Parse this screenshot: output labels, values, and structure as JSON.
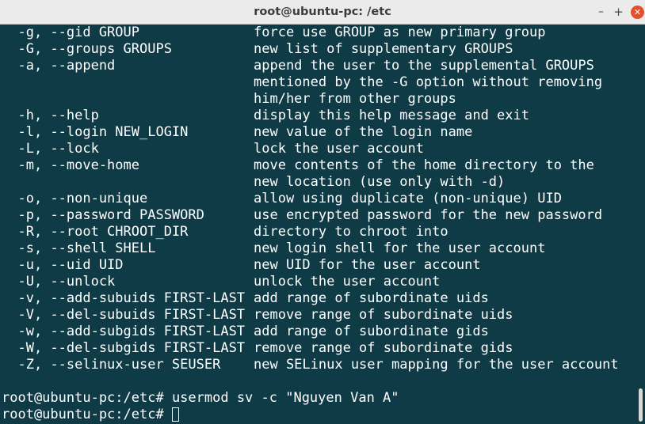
{
  "window": {
    "title": "root@ubuntu-pc: /etc",
    "minimize_symbol": "–",
    "maximize_symbol": "+",
    "close_symbol": "✕"
  },
  "terminal": {
    "help_lines": [
      {
        "option": "  -g, --gid GROUP",
        "description": "force use GROUP as new primary group"
      },
      {
        "option": "  -G, --groups GROUPS",
        "description": "new list of supplementary GROUPS"
      },
      {
        "option": "  -a, --append",
        "description": "append the user to the supplemental GROUPS"
      },
      {
        "option": "",
        "description": "mentioned by the -G option without removing"
      },
      {
        "option": "",
        "description": "him/her from other groups"
      },
      {
        "option": "  -h, --help",
        "description": "display this help message and exit"
      },
      {
        "option": "  -l, --login NEW_LOGIN",
        "description": "new value of the login name"
      },
      {
        "option": "  -L, --lock",
        "description": "lock the user account"
      },
      {
        "option": "  -m, --move-home",
        "description": "move contents of the home directory to the"
      },
      {
        "option": "",
        "description": "new location (use only with -d)"
      },
      {
        "option": "  -o, --non-unique",
        "description": "allow using duplicate (non-unique) UID"
      },
      {
        "option": "  -p, --password PASSWORD",
        "description": "use encrypted password for the new password"
      },
      {
        "option": "  -R, --root CHROOT_DIR",
        "description": "directory to chroot into"
      },
      {
        "option": "  -s, --shell SHELL",
        "description": "new login shell for the user account"
      },
      {
        "option": "  -u, --uid UID",
        "description": "new UID for the user account"
      },
      {
        "option": "  -U, --unlock",
        "description": "unlock the user account"
      },
      {
        "option": "  -v, --add-subuids FIRST-LAST",
        "description": "add range of subordinate uids"
      },
      {
        "option": "  -V, --del-subuids FIRST-LAST",
        "description": "remove range of subordinate uids"
      },
      {
        "option": "  -w, --add-subgids FIRST-LAST",
        "description": "add range of subordinate gids"
      },
      {
        "option": "  -W, --del-subgids FIRST-LAST",
        "description": "remove range of subordinate gids"
      },
      {
        "option": "  -Z, --selinux-user SEUSER",
        "description": "new SELinux user mapping for the user account"
      }
    ],
    "prompt": "root@ubuntu-pc:/etc#",
    "last_command": " usermod sv -c \"Nguyen Van A\"",
    "current_input": " "
  },
  "colors": {
    "terminal_background": "#0f3b47",
    "terminal_text": "#ffffff",
    "close_button": "#e2502c"
  }
}
